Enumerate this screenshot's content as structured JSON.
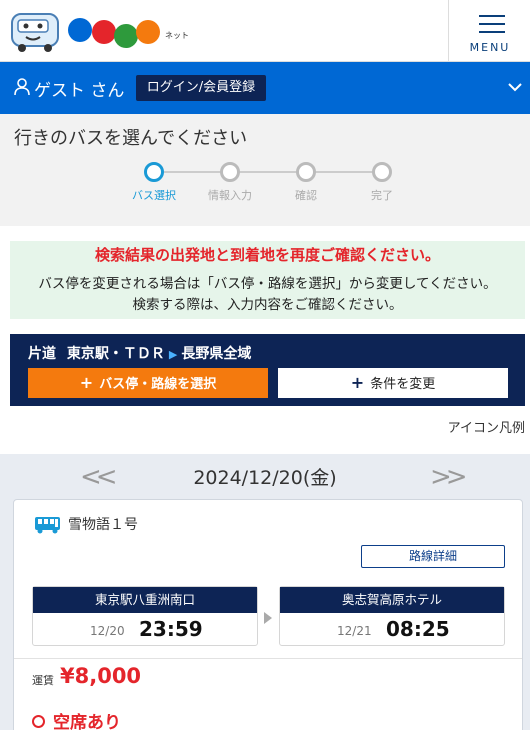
{
  "header": {
    "logo_text": "高速バス",
    "logo_suffix": "ネット",
    "menu_label": "MENU"
  },
  "userbar": {
    "user_name": "ゲスト さん",
    "login_label": "ログイン/会員登録"
  },
  "steps": {
    "heading": "行きのバスを選んでください",
    "items": [
      {
        "label": "バス選択",
        "active": true
      },
      {
        "label": "情報入力",
        "active": false
      },
      {
        "label": "確認",
        "active": false
      },
      {
        "label": "完了",
        "active": false
      }
    ]
  },
  "notice": {
    "line1": "検索結果の出発地と到着地を再度ご確認ください。",
    "line2": "バス停を変更される場合は「バス停・路線を選択」から変更してください。",
    "line3": "検索する際は、入力内容をご確認ください。"
  },
  "route": {
    "trip_type": "片道",
    "origin": "東京駅・ＴＤＲ",
    "destination": "長野県全域",
    "select_button": "バス停・路線を選択",
    "change_button": "条件を変更"
  },
  "legend_link": "アイコン凡例",
  "datebar": {
    "date": "2024/12/20(金)"
  },
  "result": {
    "bus_name": "雪物語１号",
    "detail_button": "路線詳細",
    "departure": {
      "stop": "東京駅八重洲南口",
      "date": "12/20",
      "time": "23:59"
    },
    "arrival": {
      "stop": "奥志賀高原ホテル",
      "date": "12/21",
      "time": "08:25"
    },
    "fare_label": "運賃",
    "fare": "¥8,000",
    "availability": "空席あり"
  },
  "colors": {
    "primary_blue": "#0068d4",
    "navy": "#0d2455",
    "orange": "#f47a0e",
    "red": "#e4252b",
    "step_active": "#1a9ad6"
  }
}
